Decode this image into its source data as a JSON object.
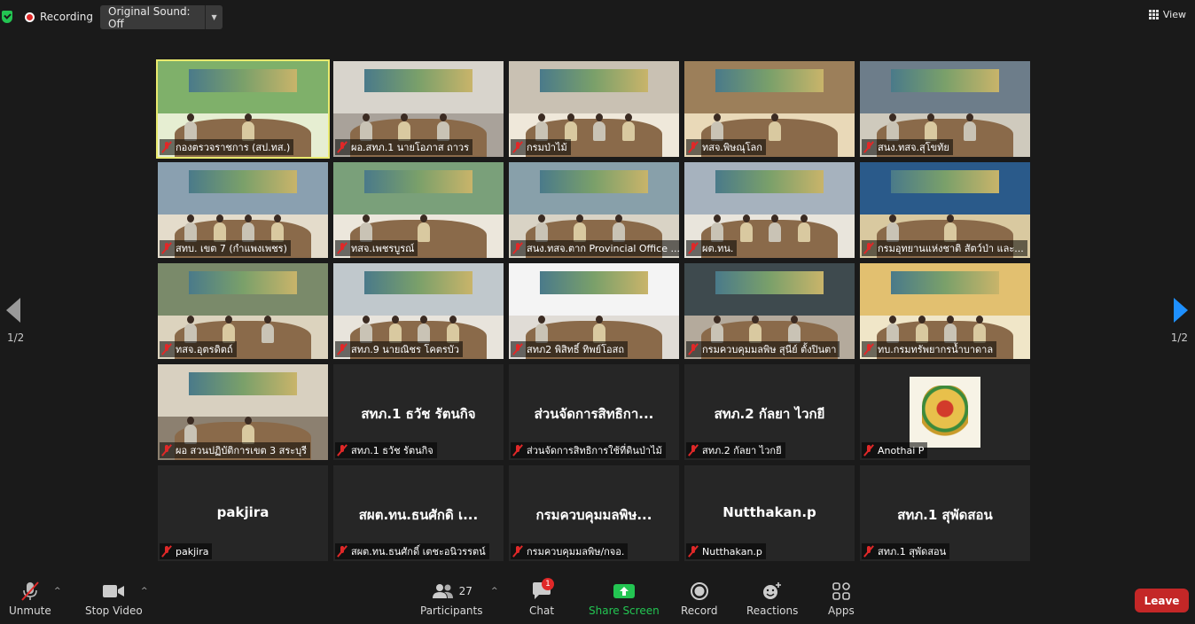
{
  "topbar": {
    "recording_label": "Recording",
    "original_sound_label": "Original Sound: Off",
    "view_label": "View"
  },
  "pagination": {
    "left_page": "1/2",
    "right_page": "1/2"
  },
  "tiles": [
    {
      "name": "กองตรวจราชการ (สป.ทส.)",
      "video": true
    },
    {
      "name": "ผอ.สทภ.1 นายโอภาส ถาวร",
      "video": true
    },
    {
      "name": "กรมป่าไม้",
      "video": true
    },
    {
      "name": "ทสจ.พิษณุโลก",
      "video": true
    },
    {
      "name": "สนง.ทสจ.สุโขทัย",
      "video": true
    },
    {
      "name": "สทบ. เขต 7 (กำแพงเพชร)",
      "video": true
    },
    {
      "name": "ทสจ.เพชรบูรณ์",
      "video": true
    },
    {
      "name": "สนง.ทสจ.ตาก Provincial Office ...",
      "video": true
    },
    {
      "name": "ผต.ทน.",
      "video": true
    },
    {
      "name": "กรมอุทยานแห่งชาติ สัตว์ป่า และ...",
      "video": true
    },
    {
      "name": "ทสจ.อุตรดิตถ์",
      "video": true
    },
    {
      "name": "สทภ.9 นายณิชร โคตรบัว",
      "video": true
    },
    {
      "name": "สทภ2 พิสิทธิ์ ทิพย์โอสถ",
      "video": true
    },
    {
      "name": "กรมควบคุมมลพิษ สุนีย์ ตั้งปินตา",
      "video": true
    },
    {
      "name": "ทบ.กรมทรัพยากรน้ำบาดาล",
      "video": true
    },
    {
      "name": "ผอ สวนปฏิบัติการเขต 3 สระบุรี",
      "video": true
    },
    {
      "name": "สทภ.1 ธวัช รัตนกิจ",
      "big": "สทภ.1 ธวัช รัตนกิจ"
    },
    {
      "name": "ส่วนจัดการสิทธิการใช้ที่ดินป่าไม้",
      "big": "ส่วนจัดการสิทธิกา..."
    },
    {
      "name": "สทภ.2 กัลยา ไวกยี",
      "big": "สทภ.2 กัลยา ไวกยี"
    },
    {
      "name": "Anothai P",
      "logo": true
    },
    {
      "name": "pakjira",
      "big": "pakjira"
    },
    {
      "name": "สผต.ทน.ธนศักดิ์ เตชะอนิวรรตน์",
      "big": "สผต.ทน.ธนศักดิ เ..."
    },
    {
      "name": "กรมควบคุมมลพิษ/กจอ.",
      "big": "กรมควบคุมมลพิษ..."
    },
    {
      "name": "Nutthakan.p",
      "big": "Nutthakan.p"
    },
    {
      "name": "สทภ.1 สุพัดสอน",
      "big": "สทภ.1 สุพัดสอน"
    }
  ],
  "toolbar": {
    "unmute_label": "Unmute",
    "stop_video_label": "Stop Video",
    "participants_label": "Participants",
    "participants_count": "27",
    "chat_label": "Chat",
    "chat_badge": "1",
    "share_screen_label": "Share Screen",
    "record_label": "Record",
    "reactions_label": "Reactions",
    "apps_label": "Apps",
    "leave_label": "Leave"
  },
  "colors": {
    "accent_green": "#23c552",
    "active_speaker_border": "#e9ea6e",
    "leave_red": "#c42727",
    "muted_red": "#e02828",
    "nav_blue": "#1e90ff"
  }
}
